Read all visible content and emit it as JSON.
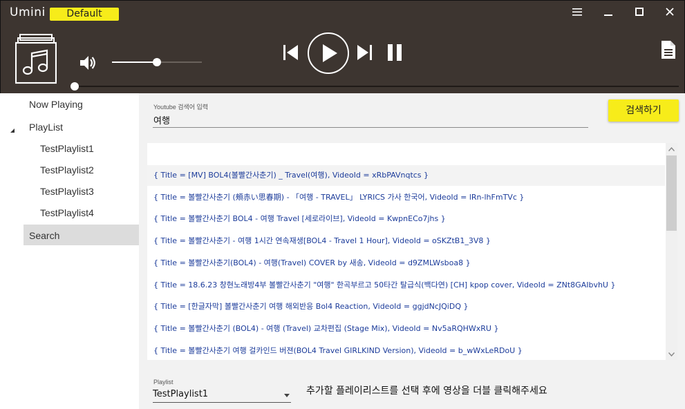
{
  "window": {
    "title": "Umini",
    "profile": "Default"
  },
  "icons": {
    "menu": "hamburger-icon",
    "minimize": "minimize-icon",
    "maximize": "maximize-icon",
    "close": "close-icon",
    "album": "music-note-icon",
    "volume": "speaker-icon",
    "previous": "skip-previous-icon",
    "play": "play-icon",
    "next": "skip-next-icon",
    "pause": "pause-icon",
    "document": "document-icon"
  },
  "player": {
    "volume_fraction": 0.5,
    "seek_fraction": 0.0
  },
  "sidebar": {
    "now_playing": "Now Playing",
    "playlist": "PlayList",
    "playlists": [
      "TestPlaylist1",
      "TestPlaylist2",
      "TestPlaylist3",
      "TestPlaylist4"
    ],
    "search": "Search"
  },
  "search": {
    "label": "Youtube 검색어 입력",
    "value": "여행",
    "button": "검색하기"
  },
  "results": [
    "{ Title = [MV] BOL4(볼빨간사춘기) _ Travel(여행), VideoId = xRbPAVnqtcs }",
    "{ Title = 볼빨간사춘기 (頰赤い思春期) - 「여행 - TRAVEL」 LYRICS 가사 한국어, VideoId = lRn-lhFmTVc }",
    "{ Title = 볼빨간사춘기 BOL4 - 여행 Travel [세로라이브], VideoId = KwpnECo7jhs }",
    "{ Title = 볼빨간사춘기 - 여행 1시간 연속재생[BOL4 - Travel 1 Hour], VideoId = oSKZtB1_3V8 }",
    "{ Title = 볼빨간사춘기(BOL4) - 여행(Travel) COVER by 새송, VideoId = d9ZMLWsboa8 }",
    "{ Title = 18.6.23 창현노래방4부 볼빨간사춘기 \"여행\" 한곡부르고 50타간 탈급식(백다연) [CH] kpop cover, VideoId = ZNt8GAIbvhU }",
    "{ Title = [한글자막] 볼빨간사춘기 여행 해외반응 Bol4 Reaction, VideoId = ggjdNcJQiDQ }",
    "{ Title = 볼빨간사춘기 (BOL4) - 여행 (Travel) 교차편집 (Stage Mix), VideoId = Nv5aRQHWxRU }",
    "{ Title = 볼빨간사춘기 여행 걸카인드 버젼(BOL4 Travel GIRLKIND Version), VideoId = b_wWxLeRDoU }"
  ],
  "playlist_picker": {
    "label": "Playlist",
    "value": "TestPlaylist1",
    "hint": "추가할 플레이리스트를 선택 후에 영상을 더블 클릭해주세요"
  },
  "colors": {
    "header_bg": "#3d3530",
    "accent_yellow": "#f7ec1a",
    "result_text": "#1b3b9a",
    "main_bg": "#f2f2f2",
    "sidebar_selected": "#dcdcdc"
  }
}
